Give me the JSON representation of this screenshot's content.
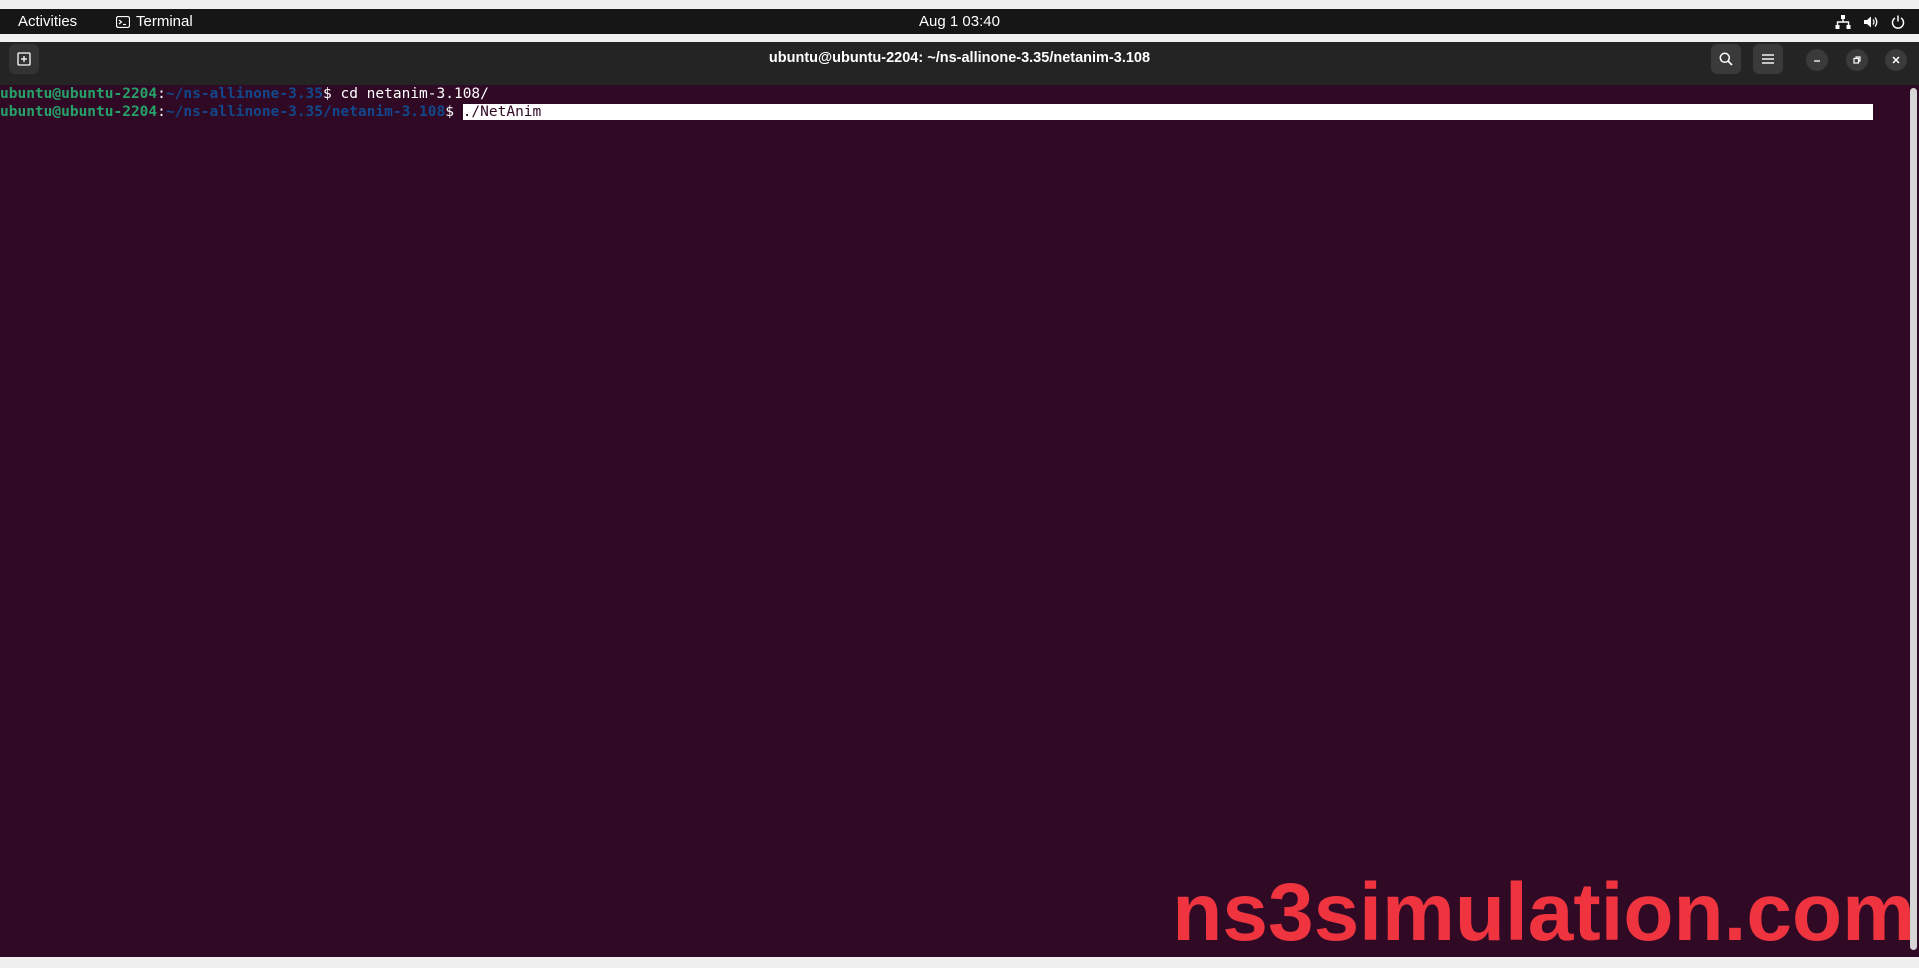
{
  "topbar": {
    "activities_label": "Activities",
    "app_label": "Terminal",
    "clock": "Aug 1  03:40",
    "tray_icons": [
      "network-icon",
      "volume-icon",
      "power-icon"
    ]
  },
  "window": {
    "title": "ubuntu@ubuntu-2204: ~/ns-allinone-3.35/netanim-3.108",
    "header_icons": [
      "new-tab-icon",
      "search-icon",
      "hamburger-menu-icon",
      "minimize-icon",
      "restore-icon",
      "close-icon"
    ]
  },
  "terminal": {
    "lines": [
      {
        "user": "ubuntu@ubuntu-2204",
        "sep": ":",
        "path": "~/ns-allinone-3.35",
        "prompt": "$ ",
        "command": "cd netanim-3.108/"
      },
      {
        "user": "ubuntu@ubuntu-2204",
        "sep": ":",
        "path": "~/ns-allinone-3.35/netanim-3.108",
        "prompt": "$ ",
        "command": "./NetAnim"
      }
    ]
  },
  "watermark": "ns3simulation.com",
  "colors": {
    "terminal_bg": "#300a24",
    "user_green": "#26a269",
    "path_blue": "#12488b",
    "watermark_red": "#ef3440"
  }
}
